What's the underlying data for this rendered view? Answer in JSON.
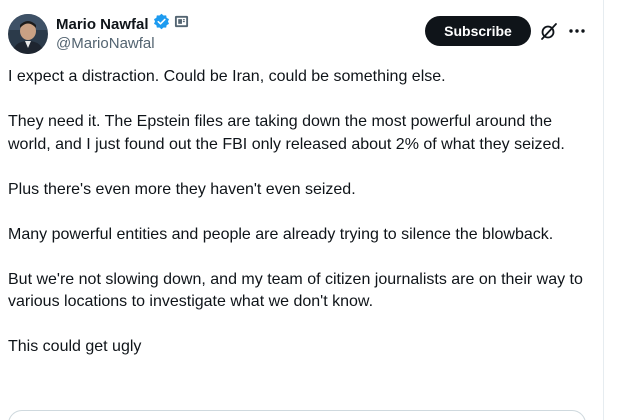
{
  "author": {
    "display_name": "Mario Nawfal",
    "handle": "@MarioNawfal",
    "verified": true,
    "icons": [
      "avatar",
      "verified-badge-icon",
      "affiliate-badge-icon"
    ]
  },
  "actions": {
    "subscribe_label": "Subscribe",
    "icons": [
      "grok-icon",
      "more-options-icon"
    ]
  },
  "tweet": {
    "paragraphs": [
      "I expect a distraction. Could be Iran, could be something else.",
      "They need it. The Epstein files are taking down the most powerful around the world, and I just found out the FBI only released about 2% of what they seized.",
      "Plus there's even more they haven't even seized.",
      "Many powerful entities and people are already trying to silence the blowback.",
      "But we're not slowing down, and my team of citizen journalists are on their way to various locations to investigate what we don't know.",
      "This could get ugly"
    ]
  },
  "colors": {
    "text": "#0f1419",
    "secondary_text": "#536471",
    "verified_blue": "#1d9bf0",
    "button_bg": "#0f1419",
    "button_text": "#ffffff",
    "border": "#cfd9de"
  }
}
